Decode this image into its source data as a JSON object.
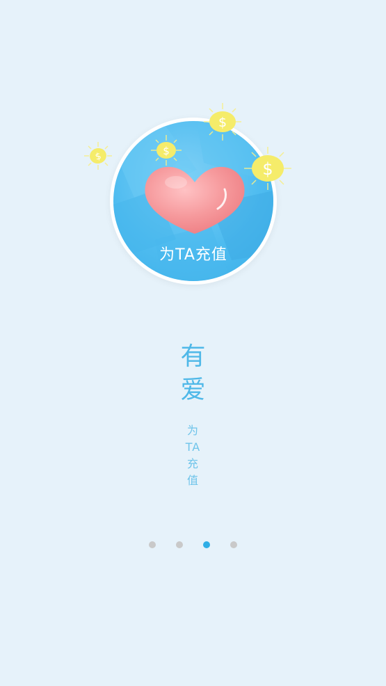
{
  "hero": {
    "caption": "为TA充值",
    "coin_symbol": "$",
    "icon": "heart-icon"
  },
  "title": {
    "chars": [
      "有",
      "爱"
    ]
  },
  "subtitle": {
    "chars": [
      "为",
      "TA",
      "充",
      "值"
    ]
  },
  "pager": {
    "total": 4,
    "active_index": 2
  },
  "colors": {
    "background": "#e6f2fa",
    "accent": "#4fb8e8",
    "dot_active": "#2faee6",
    "dot_inactive": "#c9c9c9",
    "heart": "#f48e92",
    "coin": "#f5ec6a"
  }
}
